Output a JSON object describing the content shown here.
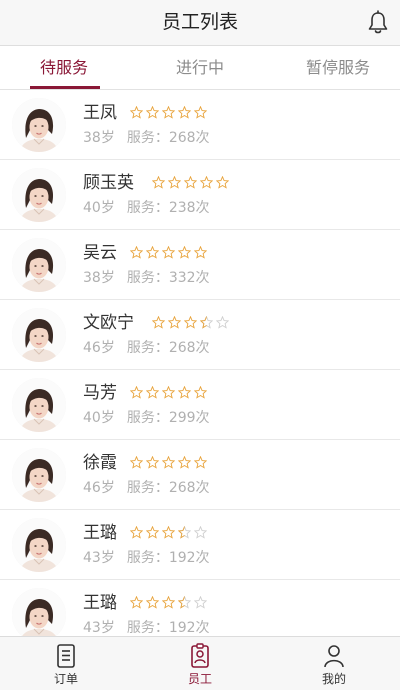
{
  "header": {
    "title": "员工列表",
    "bell_icon": "bell-icon"
  },
  "tabs": [
    {
      "label": "待服务",
      "active": true
    },
    {
      "label": "进行中",
      "active": false
    },
    {
      "label": "暂停服务",
      "active": false
    }
  ],
  "colors": {
    "accent": "#8a1736",
    "star": "#e8a33a",
    "muted": "#b0b0b0"
  },
  "staff": [
    {
      "name": "王凤",
      "rating": 5,
      "age": "38岁",
      "service": "服务：268次"
    },
    {
      "name": "顾玉英",
      "rating": 5,
      "age": "40岁",
      "service": "服务：238次"
    },
    {
      "name": "吴云",
      "rating": 5,
      "age": "38岁",
      "service": "服务：332次"
    },
    {
      "name": "文欧宁",
      "rating": 3.5,
      "age": "46岁",
      "service": "服务：268次"
    },
    {
      "name": "马芳",
      "rating": 5,
      "age": "40岁",
      "service": "服务：299次"
    },
    {
      "name": "徐霞",
      "rating": 5,
      "age": "46岁",
      "service": "服务：268次"
    },
    {
      "name": "王璐",
      "rating": 3.5,
      "age": "43岁",
      "service": "服务：192次"
    },
    {
      "name": "王璐",
      "rating": 3.5,
      "age": "43岁",
      "service": "服务：192次"
    }
  ],
  "bottom_nav": [
    {
      "label": "订单",
      "icon": "orders-icon",
      "active": false
    },
    {
      "label": "员工",
      "icon": "staff-icon",
      "active": true
    },
    {
      "label": "我的",
      "icon": "profile-icon",
      "active": false
    }
  ]
}
